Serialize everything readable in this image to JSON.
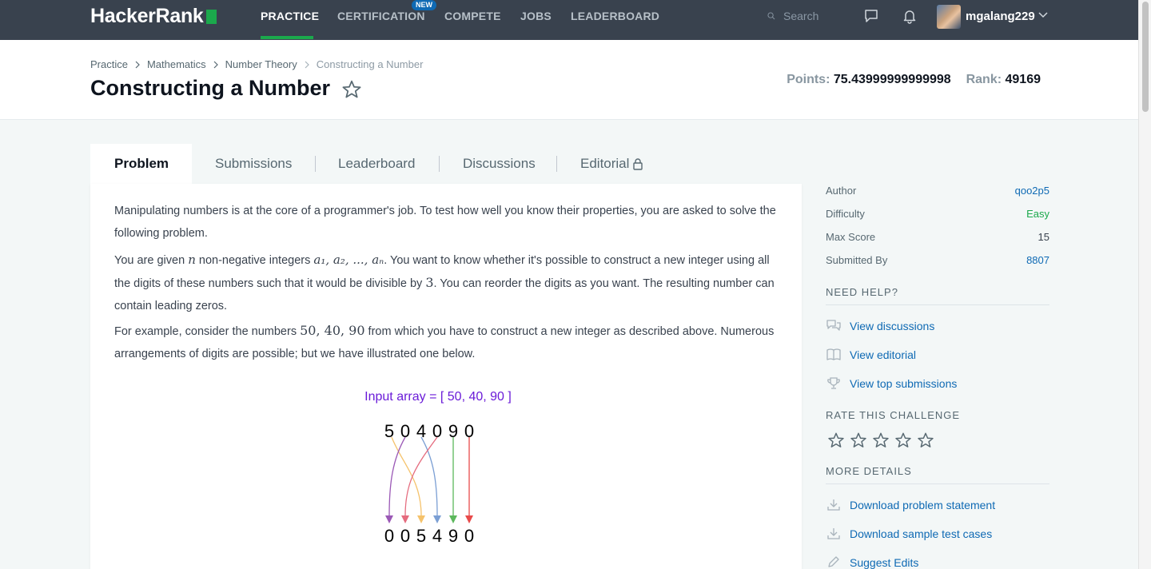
{
  "topnav": {
    "logo": "HackerRank",
    "items": [
      {
        "label": "PRACTICE"
      },
      {
        "label": "CERTIFICATION"
      },
      {
        "label": "COMPETE"
      },
      {
        "label": "JOBS"
      },
      {
        "label": "LEADERBOARD"
      }
    ],
    "new_badge": "NEW",
    "search_placeholder": "Search",
    "username": "mgalang229",
    "accent_color": "#1ba94c"
  },
  "header": {
    "breadcrumb": [
      "Practice",
      "Mathematics",
      "Number Theory",
      "Constructing a Number"
    ],
    "title": "Constructing a Number",
    "points_label": "Points:",
    "points_value": "75.43999999999998",
    "rank_label": "Rank:",
    "rank_value": "49169"
  },
  "tabs": [
    {
      "label": "Problem"
    },
    {
      "label": "Submissions"
    },
    {
      "label": "Leaderboard"
    },
    {
      "label": "Discussions"
    },
    {
      "label": "Editorial"
    }
  ],
  "problem": {
    "p1": "Manipulating numbers is at the core of a programmer's job. To test how well you know their properties, you are asked to solve the following problem.",
    "p2_a": "You are given ",
    "p2_n": "n",
    "p2_b": " non-negative integers ",
    "p2_vars": "a₁, a₂, ..., aₙ",
    "p2_c": ". You want to know whether it's possible to construct a new integer using all the digits of these numbers such that it would be divisible by ",
    "p2_three": "3",
    "p2_d": ". You can reorder the digits as you want. The resulting number can contain leading zeros.",
    "p3_a": "For example, consider the numbers ",
    "p3_nums": "50, 40, 90",
    "p3_b": " from which you have to construct a new integer as described above. Numerous arrangements of digits are possible; but we have illustrated one below.",
    "figure": {
      "caption": "Input array = [ 50, 40, 90 ]",
      "top_digits": [
        "5",
        "0",
        "4",
        "0",
        "9",
        "0"
      ],
      "bottom_digits": [
        "0",
        "0",
        "5",
        "4",
        "9",
        "0"
      ]
    }
  },
  "sidebar": {
    "info": [
      {
        "key": "Author",
        "value": "qoo2p5"
      },
      {
        "key": "Difficulty",
        "value": "Easy"
      },
      {
        "key": "Max Score",
        "value": "15"
      },
      {
        "key": "Submitted By",
        "value": "8807"
      }
    ],
    "need_help_title": "NEED HELP?",
    "help_links": [
      "View discussions",
      "View editorial",
      "View top submissions"
    ],
    "rate_title": "RATE THIS CHALLENGE",
    "more_title": "MORE DETAILS",
    "more_links": [
      "Download problem statement",
      "Download sample test cases",
      "Suggest Edits"
    ]
  }
}
